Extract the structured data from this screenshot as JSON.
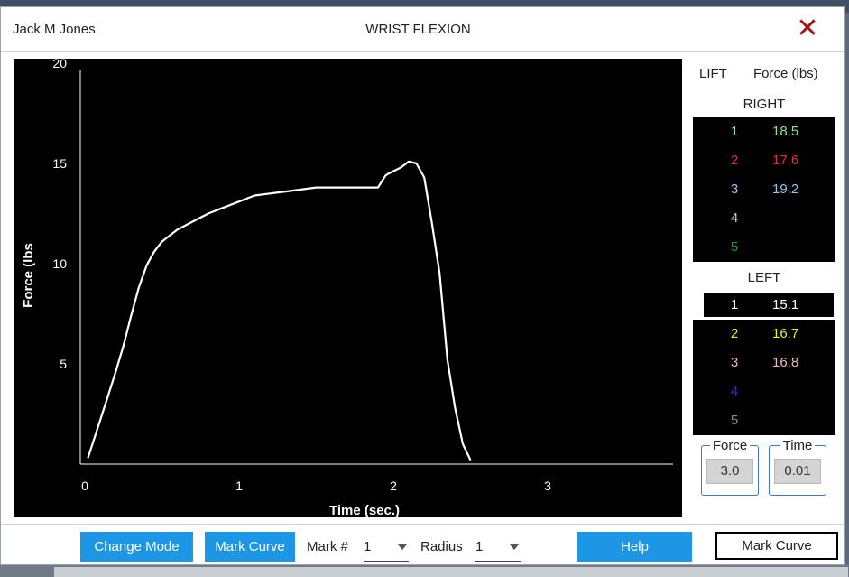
{
  "header": {
    "patient_name": "Jack M Jones",
    "test_title": "WRIST FLEXION",
    "close_icon": "close-icon"
  },
  "chart_data": {
    "type": "line",
    "xlabel": "Time (sec.)",
    "ylabel": "Force (lbs",
    "xlim": [
      0,
      3.8
    ],
    "ylim": [
      0,
      20
    ],
    "x_ticks": [
      "0",
      "1",
      "2",
      "3"
    ],
    "y_ticks": [
      "20",
      "15",
      "10",
      "5"
    ],
    "grid": false,
    "series": [
      {
        "color": "#ffffff",
        "x": [
          0.02,
          0.05,
          0.1,
          0.15,
          0.2,
          0.25,
          0.3,
          0.35,
          0.4,
          0.45,
          0.5,
          0.55,
          0.6,
          0.7,
          0.8,
          0.9,
          1.0,
          1.1,
          1.2,
          1.3,
          1.4,
          1.5,
          1.6,
          1.7,
          1.8,
          1.9,
          1.95,
          1.97,
          2.05,
          2.1,
          2.15,
          2.2,
          2.25,
          2.3,
          2.35,
          2.4,
          2.45,
          2.5
        ],
        "y": [
          0.3,
          1.0,
          2.2,
          3.4,
          4.6,
          5.9,
          7.4,
          8.8,
          9.9,
          10.6,
          11.1,
          11.4,
          11.7,
          12.1,
          12.5,
          12.8,
          13.1,
          13.4,
          13.5,
          13.6,
          13.7,
          13.8,
          13.8,
          13.8,
          13.8,
          13.8,
          14.4,
          14.5,
          14.8,
          15.1,
          15.0,
          14.3,
          12.0,
          9.5,
          5.2,
          2.8,
          1.0,
          0.2
        ]
      }
    ]
  },
  "side": {
    "col_lift": "LIFT",
    "col_force": "Force (lbs)",
    "right_label": "RIGHT",
    "left_label": "LEFT",
    "right_rows": [
      {
        "n": "1",
        "v": "18.5",
        "color": "#8fe38f"
      },
      {
        "n": "2",
        "v": "17.6",
        "color": "#e23030"
      },
      {
        "n": "3",
        "v": "19.2",
        "color": "#8fc6ea"
      },
      {
        "n": "4",
        "v": "",
        "color": "#a8d8ef"
      },
      {
        "n": "5",
        "v": "",
        "color": "#1f9b2b"
      }
    ],
    "left_rows": [
      {
        "n": "1",
        "v": "15.1",
        "color": "#ffffff",
        "selected": true
      },
      {
        "n": "2",
        "v": "16.7",
        "color": "#f2e530"
      },
      {
        "n": "3",
        "v": "16.8",
        "color": "#f2b6b6"
      },
      {
        "n": "4",
        "v": "",
        "color": "#2a2ae8"
      },
      {
        "n": "5",
        "v": "",
        "color": "#8a8a8a"
      }
    ],
    "force_label": "Force",
    "force_value": "3.0",
    "time_label": "Time",
    "time_value": "0.01"
  },
  "footer": {
    "change_mode": "Change Mode",
    "mark_curve": "Mark Curve",
    "mark_label": "Mark #",
    "mark_value": "1",
    "radius_label": "Radius",
    "radius_value": "1",
    "help": "Help",
    "mark_curve_outline": "Mark Curve"
  }
}
